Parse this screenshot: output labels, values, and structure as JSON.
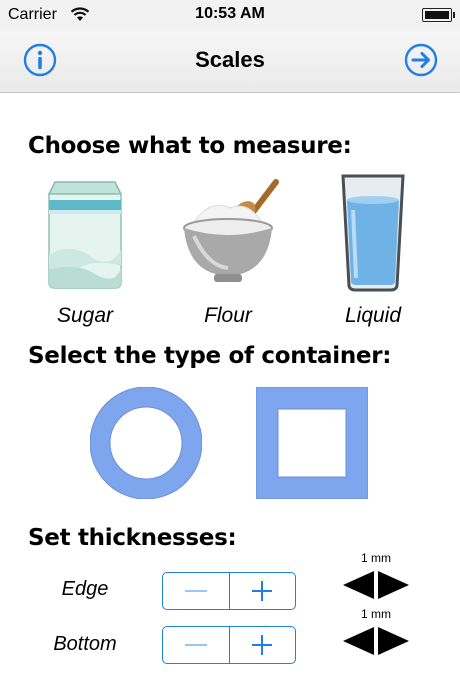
{
  "status_bar": {
    "carrier": "Carrier",
    "time": "10:53 AM",
    "icons": [
      "wifi-icon",
      "battery-icon"
    ]
  },
  "nav": {
    "title": "Scales",
    "left_icon": "info-icon",
    "right_icon": "arrow-right-icon"
  },
  "measure": {
    "heading": "Choose what to measure:",
    "options": [
      {
        "label": "Sugar",
        "icon": "sugar-bag-icon"
      },
      {
        "label": "Flour",
        "icon": "flour-bowl-icon"
      },
      {
        "label": "Liquid",
        "icon": "water-glass-icon"
      }
    ]
  },
  "container": {
    "heading": "Select the type of container:",
    "options": [
      "round-container-icon",
      "square-container-icon"
    ]
  },
  "thickness": {
    "heading": "Set thicknesses:",
    "rows": [
      {
        "label": "Edge",
        "value": "1 mm"
      },
      {
        "label": "Bottom",
        "value": "1 mm"
      }
    ]
  },
  "colors": {
    "accent": "#1f7fe6",
    "container_fill": "#7da6ef"
  }
}
